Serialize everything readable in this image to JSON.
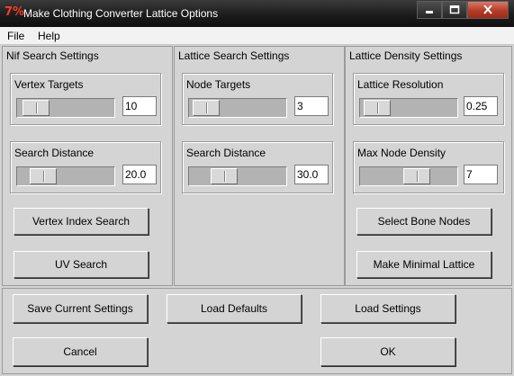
{
  "window": {
    "title": "Make Clothing Converter Lattice Options",
    "icon": "app-icon",
    "controls": {
      "minimize": "minimize-icon",
      "maximize": "maximize-icon",
      "close": "close-icon"
    }
  },
  "menu": [
    "File",
    "Help"
  ],
  "nif": {
    "title": "Nif Search Settings",
    "vertex_targets": {
      "label": "Vertex Targets",
      "value": "10",
      "slider_fraction": 0.15
    },
    "search_distance": {
      "label": "Search Distance",
      "value": "20.0",
      "slider_fraction": 0.2
    },
    "vertex_index_search": "Vertex Index Search",
    "uv_search": "UV Search"
  },
  "lattice_search": {
    "title": "Lattice Search Settings",
    "node_targets": {
      "label": "Node Targets",
      "value": "3",
      "slider_fraction": 0.1
    },
    "search_distance": {
      "label": "Search Distance",
      "value": "30.0",
      "slider_fraction": 0.25
    }
  },
  "lattice_density": {
    "title": "Lattice Density Settings",
    "resolution": {
      "label": "Lattice Resolution",
      "value": "0.25",
      "slider_fraction": 0.1
    },
    "max_node_density": {
      "label": "Max Node Density",
      "value": "7",
      "slider_fraction": 0.55
    },
    "select_bone_nodes": "Select Bone Nodes",
    "make_minimal_lattice": "Make Minimal Lattice"
  },
  "footer": {
    "save_current": "Save Current Settings",
    "load_defaults": "Load Defaults",
    "load_settings": "Load Settings",
    "cancel": "Cancel",
    "ok": "OK"
  }
}
